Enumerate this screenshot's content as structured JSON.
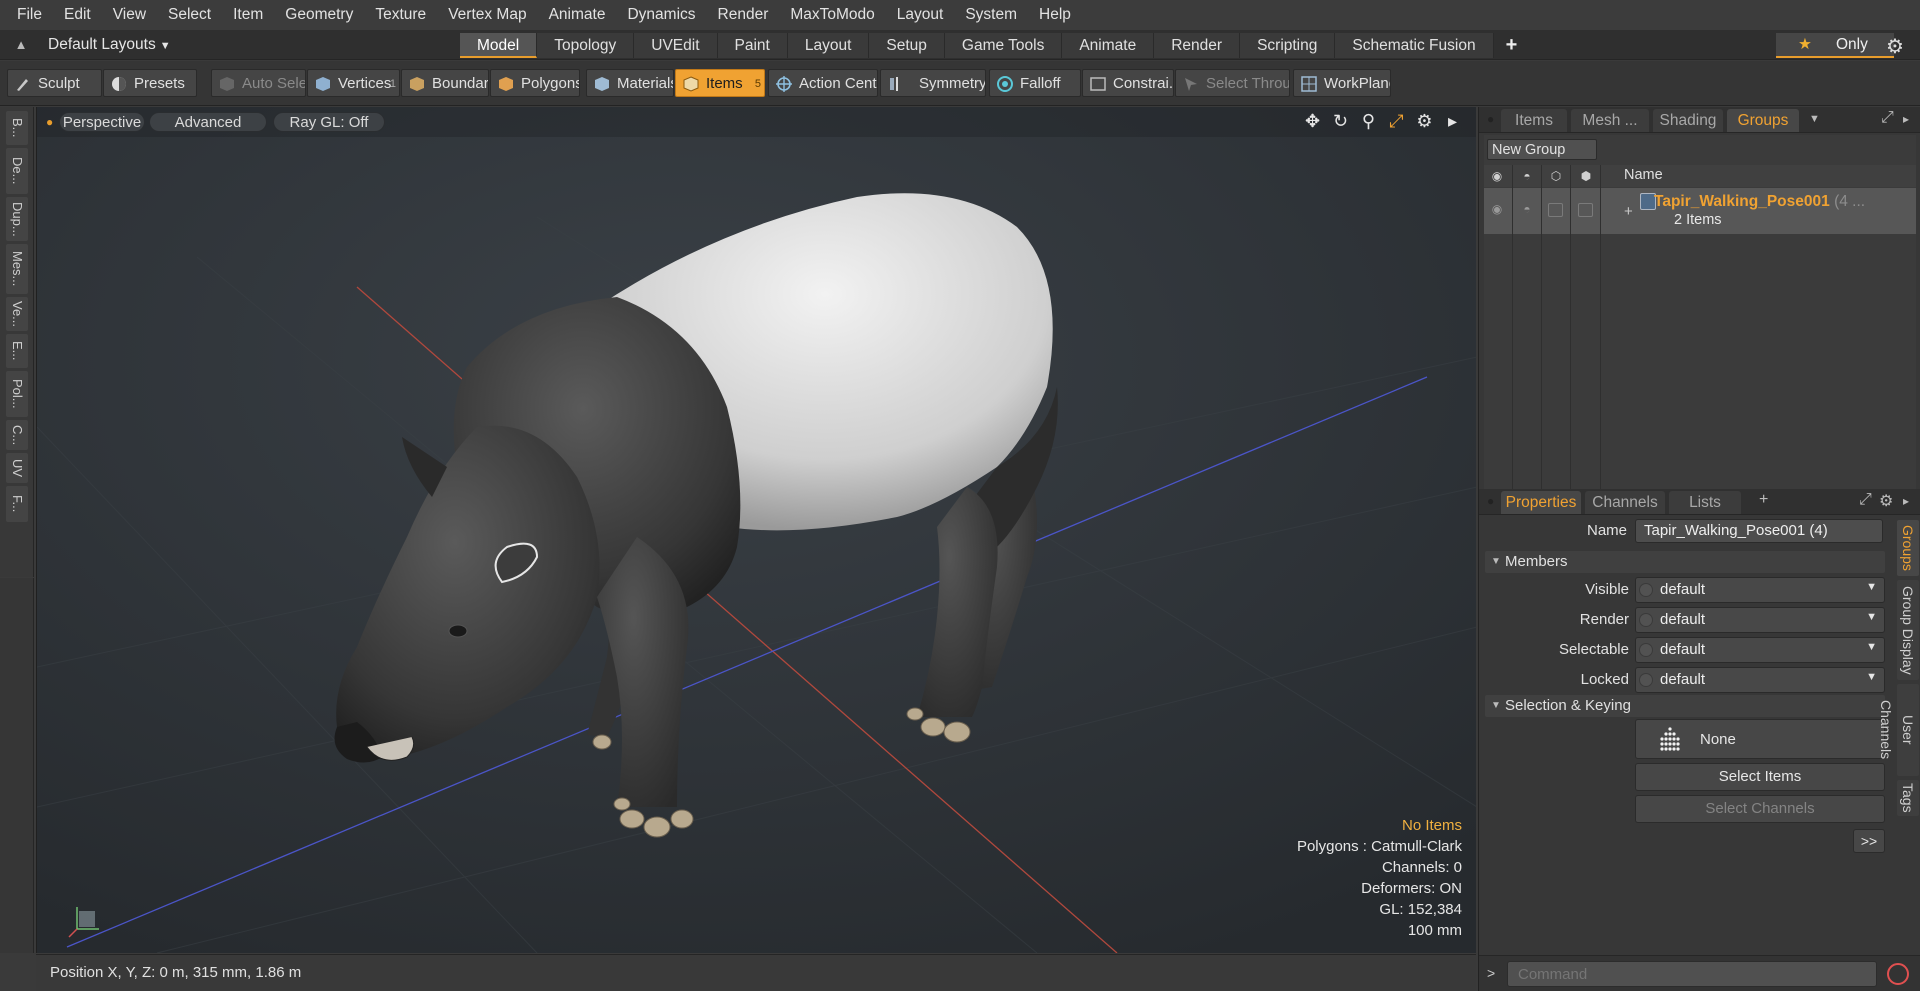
{
  "menu": [
    "File",
    "Edit",
    "View",
    "Select",
    "Item",
    "Geometry",
    "Texture",
    "Vertex Map",
    "Animate",
    "Dynamics",
    "Render",
    "MaxToModo",
    "Layout",
    "System",
    "Help"
  ],
  "layoutbar": {
    "layout_name": "Default Layouts",
    "tabs": [
      "Model",
      "Topology",
      "UVEdit",
      "Paint",
      "Layout",
      "Setup",
      "Game Tools",
      "Animate",
      "Render",
      "Scripting",
      "Schematic Fusion"
    ],
    "active_tab": "Model",
    "only_label": "Only"
  },
  "toolbar": {
    "sculpt": "Sculpt",
    "presets": "Presets",
    "auto_select": "Auto Select",
    "vertices": "Vertices",
    "vertices_count": "1",
    "boundary": "Boundary",
    "polygons": "Polygons",
    "materials": "Materials",
    "items": "Items",
    "items_count": "5",
    "action_center": "Action Center",
    "symmetry": "Symmetry",
    "falloff": "Falloff",
    "constraints": "Constrai...",
    "select_through": "Select Through",
    "workplane": "WorkPlane"
  },
  "left_tabs": [
    "B...",
    "De...",
    "Dup...",
    "Mes...",
    "Ve...",
    "E...",
    "Pol...",
    "C...",
    "UV",
    "F..."
  ],
  "viewport": {
    "view": "Perspective",
    "shading": "Advanced",
    "raygl": "Ray GL: Off",
    "info": {
      "items": "No Items",
      "polygons": "Polygons : Catmull-Clark",
      "channels": "Channels: 0",
      "deformers": "Deformers: ON",
      "gl": "GL: 152,384",
      "scale": "100 mm"
    }
  },
  "status": {
    "position": "Position X, Y, Z:   0 m, 315 mm, 1.86 m"
  },
  "right_panel": {
    "top_tabs": [
      "Items",
      "Mesh ...",
      "Shading",
      "Groups"
    ],
    "active_top_tab": "Groups",
    "new_group": "New Group",
    "list_header_name": "Name",
    "group": {
      "name": "Tapir_Walking_Pose001",
      "count_suffix": "(4 ...",
      "sub": "2 Items"
    },
    "prop_tabs": [
      "Properties",
      "Channels",
      "Lists"
    ],
    "active_prop_tab": "Properties",
    "name_label": "Name",
    "name_value": "Tapir_Walking_Pose001 (4)",
    "members_section": "Members",
    "fields": [
      {
        "label": "Visible",
        "value": "default"
      },
      {
        "label": "Render",
        "value": "default"
      },
      {
        "label": "Selectable",
        "value": "default"
      },
      {
        "label": "Locked",
        "value": "default"
      }
    ],
    "selection_section": "Selection & Keying",
    "none_label": "None",
    "select_items": "Select Items",
    "select_channels": "Select Channels",
    "more": ">>",
    "side_tabs": [
      "Groups",
      "Group Display",
      "User Channels",
      "Tags"
    ],
    "command_placeholder": "Command"
  },
  "colors": {
    "accent": "#f0a232",
    "viewport_bg": "#2b2f33",
    "panel_bg": "#373737"
  }
}
